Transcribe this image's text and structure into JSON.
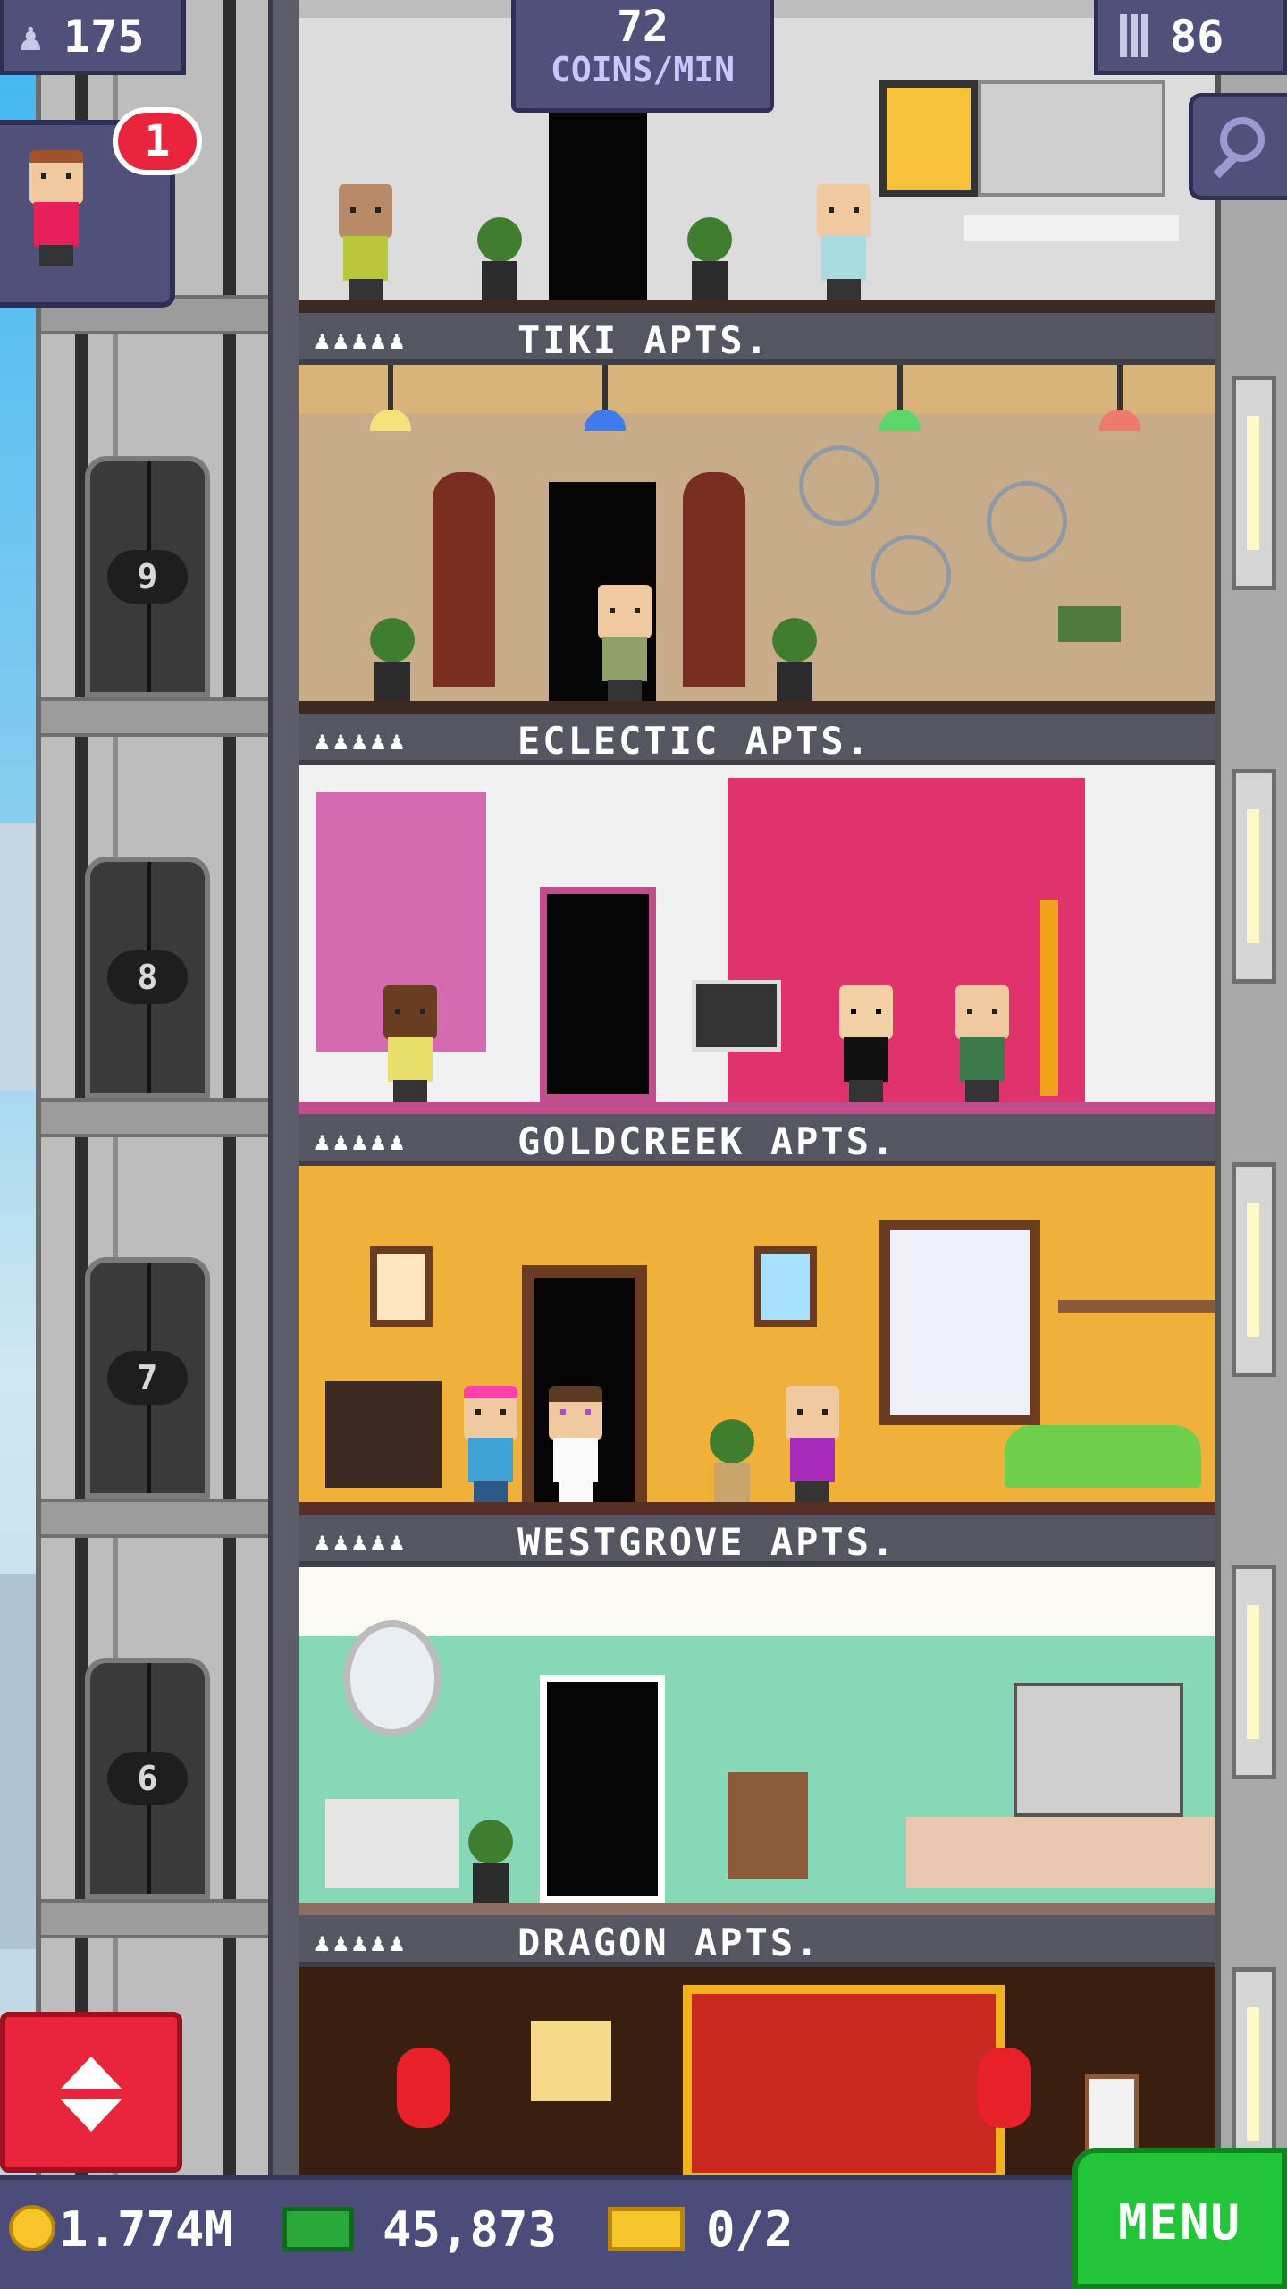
{
  "hud": {
    "population": "175",
    "coins_rate_value": "72",
    "coins_rate_unit": "COINS/MIN",
    "floors": "86",
    "visitor_badge": "1"
  },
  "floors": [
    {
      "name": "TIKI APTS.",
      "dots": "♟♟♟♟♟",
      "number": "9"
    },
    {
      "name": "ECLECTIC APTS.",
      "dots": "♟♟♟♟♟",
      "number": "8"
    },
    {
      "name": "GOLDCREEK APTS.",
      "dots": "♟♟♟♟♟",
      "number": "7"
    },
    {
      "name": "WESTGROVE APTS.",
      "dots": "♟♟♟♟♟",
      "number": "6"
    },
    {
      "name": "DRAGON APTS.",
      "dots": "♟♟♟♟♟",
      "number": ""
    }
  ],
  "bottom": {
    "coins": "1.774M",
    "bux": "45,873",
    "tickets": "0/2",
    "menu_label": "MENU"
  },
  "icons": {
    "population": "person-icon",
    "floors": "building-icon",
    "zoom": "magnifier-icon",
    "elevator": "up-down-arrows-icon",
    "coin": "coin-icon",
    "bux": "tower-bux-icon",
    "ticket": "golden-ticket-icon"
  },
  "colors": {
    "hud": "#50507a",
    "menu": "#22c43a",
    "elevator_button": "#e8253d",
    "badge": "#e8253d"
  }
}
